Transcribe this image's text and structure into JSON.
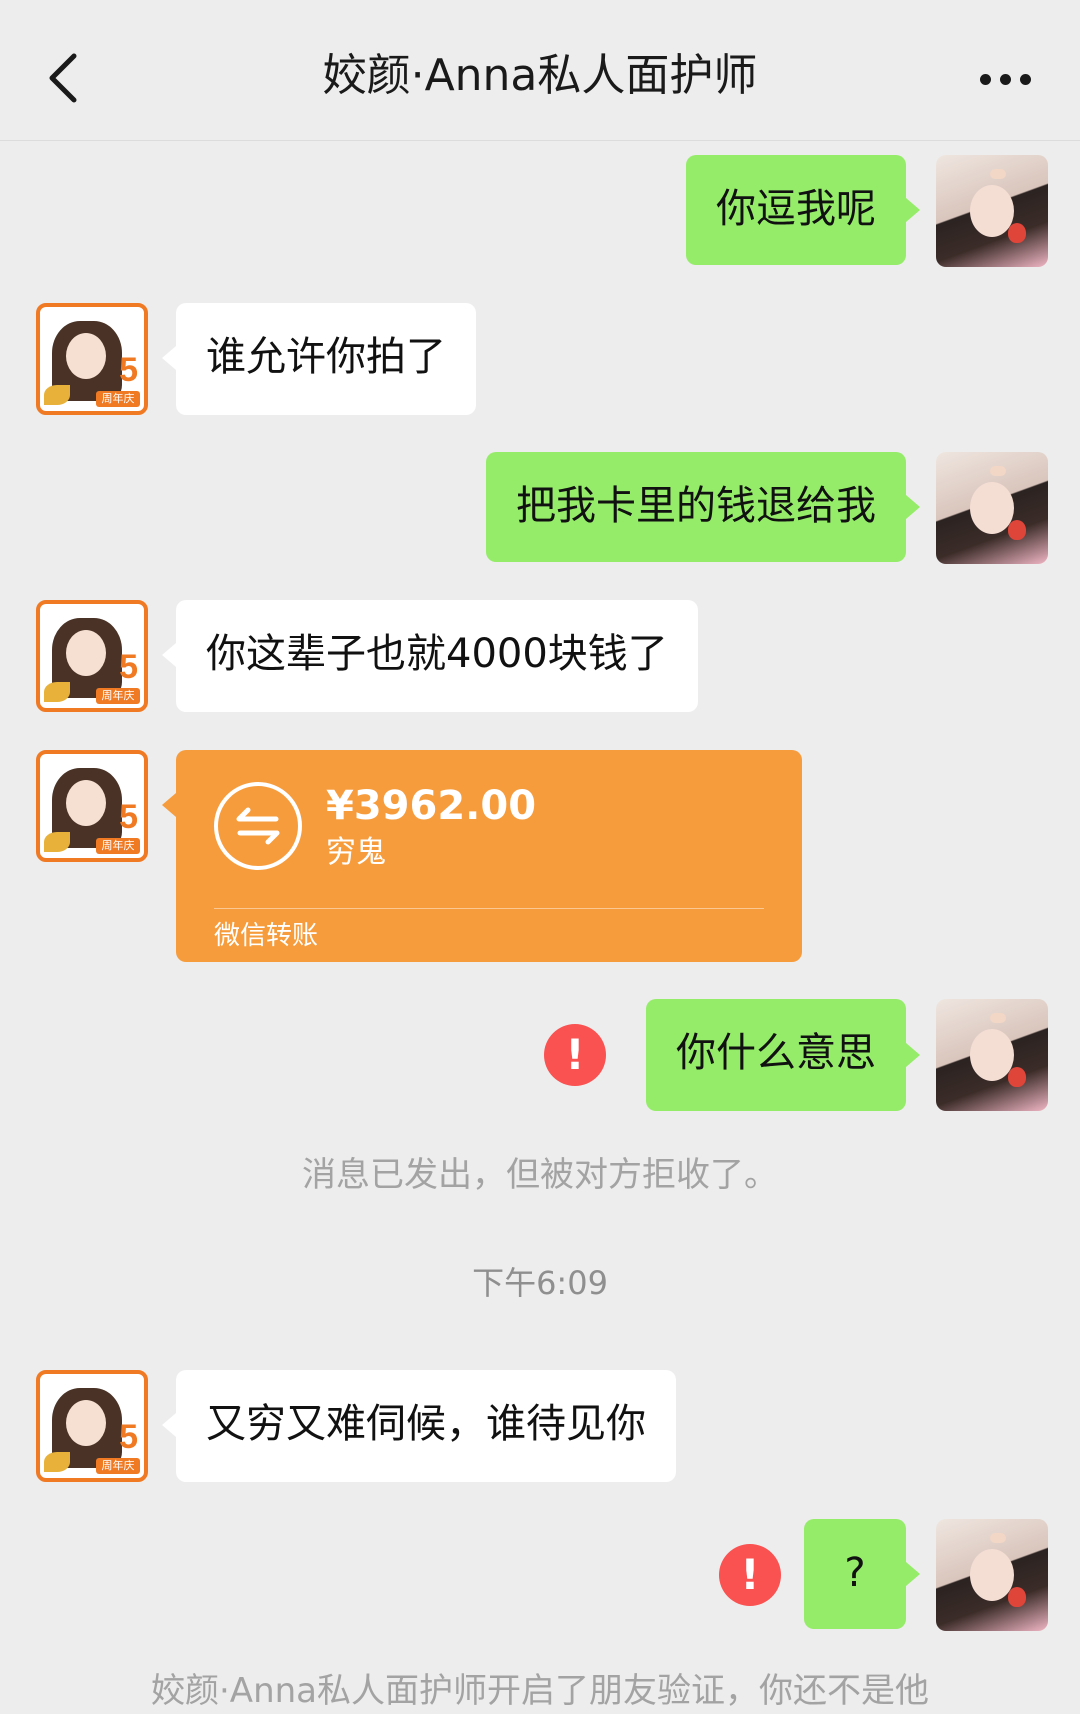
{
  "header": {
    "title": "姣颜·Anna私人面护师",
    "back_icon": "chevron-left-icon",
    "more_icon": "more-dots-icon"
  },
  "messages": [
    {
      "from": "me",
      "text": "你逗我呢"
    },
    {
      "from": "other",
      "text": "谁允许你拍了"
    },
    {
      "from": "me",
      "text": "把我卡里的钱退给我"
    },
    {
      "from": "other",
      "text": "你这辈子也就4000块钱了"
    },
    {
      "from": "other",
      "type": "transfer"
    },
    {
      "from": "me",
      "text": "你什么意思",
      "status": "failed"
    },
    {
      "from": "other",
      "text": "又穷又难伺候，谁待见你"
    },
    {
      "from": "me",
      "text": "?",
      "status": "failed"
    }
  ],
  "transfer": {
    "amount": "¥3962.00",
    "memo": "穷鬼",
    "label": "微信转账"
  },
  "system": {
    "rejected": "消息已发出，但被对方拒收了。",
    "time": "下午6:09",
    "friend_verify": "姣颜·Anna私人面护师开启了朋友验证，你还不是他"
  },
  "error_glyph": "!",
  "avatars": {
    "me": "user-avatar",
    "other": "shop-avatar",
    "shop_badge": "周年庆"
  },
  "colors": {
    "background": "#ededed",
    "me_bubble": "#95ec69",
    "other_bubble": "#ffffff",
    "transfer": "#f79c3c",
    "error": "#fa5151"
  }
}
